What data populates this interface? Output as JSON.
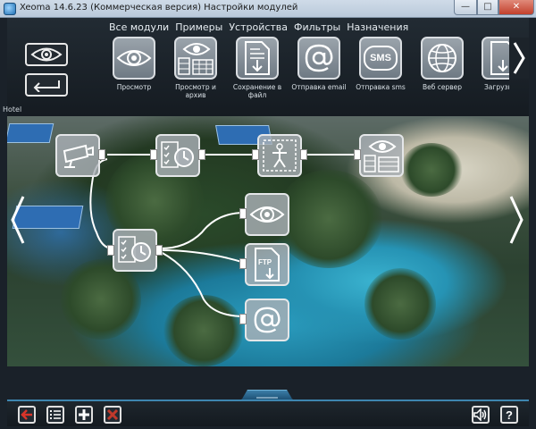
{
  "window": {
    "title": "Xeoma 14.6.23 (Коммерческая версия) Настройки модулей",
    "minimize_glyph": "—",
    "maximize_glyph": "□",
    "close_glyph": "✕"
  },
  "menu": {
    "items": [
      {
        "label": "Все модули"
      },
      {
        "label": "Примеры"
      },
      {
        "label": "Устройства"
      },
      {
        "label": "Фильтры"
      },
      {
        "label": "Назначения"
      }
    ]
  },
  "side_buttons": [
    {
      "icon": "eye-icon"
    },
    {
      "icon": "back-arrow-icon"
    }
  ],
  "modules": [
    {
      "label": "Просмотр",
      "icon": "eye-icon"
    },
    {
      "label": "Просмотр и архив",
      "icon": "eye-archive-icon"
    },
    {
      "label": "Сохранение в файл",
      "icon": "save-file-icon"
    },
    {
      "label": "Отправка email",
      "icon": "at-icon"
    },
    {
      "label": "Отправка sms",
      "icon": "sms-icon"
    },
    {
      "label": "Веб сервер",
      "icon": "globe-icon"
    },
    {
      "label": "Загрузка на FTP-се",
      "icon": "ftp-icon"
    }
  ],
  "sms_tile_text": "SMS",
  "ftp_tile_text": "FTP",
  "camera_tab": "Hotel",
  "scene_nodes": [
    {
      "name": "camera",
      "icon": "camera-icon"
    },
    {
      "name": "scheduler-1",
      "icon": "scheduler-icon"
    },
    {
      "name": "motion-detector",
      "icon": "motion-detector-icon"
    },
    {
      "name": "view-archive",
      "icon": "eye-archive-icon"
    },
    {
      "name": "scheduler-2",
      "icon": "scheduler-icon"
    },
    {
      "name": "view",
      "icon": "eye-icon"
    },
    {
      "name": "ftp-upload",
      "icon": "ftp-icon"
    },
    {
      "name": "email",
      "icon": "at-icon"
    }
  ],
  "bottom_buttons": [
    {
      "name": "exit",
      "icon": "exit-arrow-icon"
    },
    {
      "name": "list",
      "icon": "list-icon"
    },
    {
      "name": "add",
      "icon": "plus-icon"
    },
    {
      "name": "delete",
      "icon": "cross-icon"
    },
    {
      "name": "sound",
      "icon": "speaker-icon"
    },
    {
      "name": "help",
      "icon": "question-icon",
      "label": "?"
    }
  ],
  "colors": {
    "accent": "#3e86b0",
    "exit": "#d8342a",
    "delete": "#c0392b"
  }
}
